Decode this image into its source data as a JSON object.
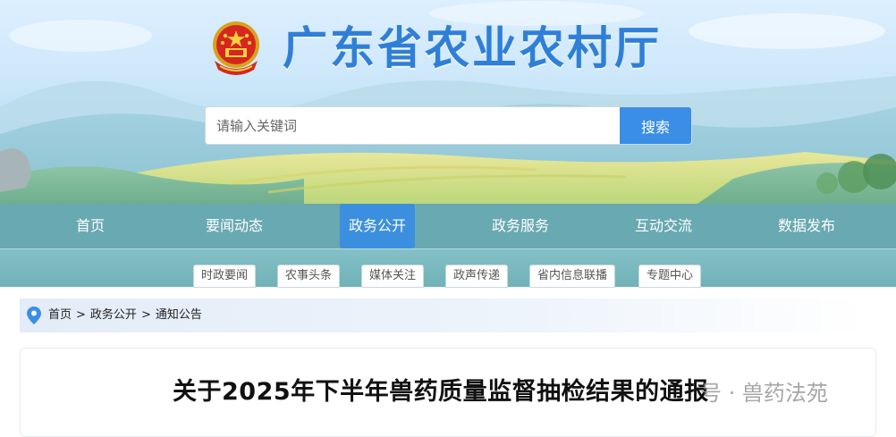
{
  "header": {
    "site_title": "广东省农业农村厅",
    "emblem_icon": "national-emblem-icon"
  },
  "search": {
    "placeholder": "请输入关键词",
    "button_label": "搜索"
  },
  "nav": {
    "items": [
      {
        "label": "首页"
      },
      {
        "label": "要闻动态"
      },
      {
        "label": "政务公开"
      },
      {
        "label": "政务服务"
      },
      {
        "label": "互动交流"
      },
      {
        "label": "数据发布"
      }
    ],
    "active": "政务公开"
  },
  "subnav": {
    "items": [
      {
        "label": "时政要闻"
      },
      {
        "label": "农事头条"
      },
      {
        "label": "媒体关注"
      },
      {
        "label": "政声传递"
      },
      {
        "label": "省内信息联播"
      },
      {
        "label": "专题中心"
      }
    ]
  },
  "breadcrumb": {
    "icon": "location-pin-icon",
    "items": [
      {
        "label": "首页"
      },
      {
        "label": "政务公开"
      },
      {
        "label": "通知公告"
      }
    ],
    "separator": ">"
  },
  "article": {
    "title": "关于2025年下半年兽药质量监督抽检结果的通报"
  },
  "watermark": {
    "text": "号 · 兽药法苑"
  },
  "colors": {
    "title_blue": "#2f7fd7",
    "nav_active": "#3b8fde",
    "search_button": "#3a8ee6",
    "nav_bg": "#5ca2ac"
  }
}
